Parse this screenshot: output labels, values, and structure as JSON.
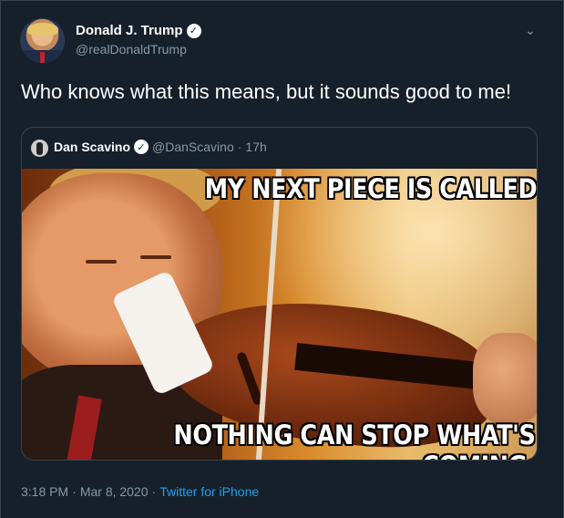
{
  "tweet": {
    "display_name": "Donald J. Trump",
    "handle": "@realDonaldTrump",
    "text": "Who knows what this means, but it sounds good to me!",
    "verified_icon": "verified-badge-icon",
    "menu_icon": "chevron-down-icon"
  },
  "quote": {
    "display_name": "Dan Scavino",
    "handle": "@DanScavino",
    "separator": "·",
    "time": "17h",
    "meme": {
      "top_text": "MY NEXT PIECE IS CALLED",
      "bottom_text": "NOTHING CAN STOP WHAT'S COMING."
    }
  },
  "meta": {
    "time": "3:18 PM",
    "separator1": "·",
    "date": "Mar 8, 2020",
    "separator2": "·",
    "source": "Twitter for iPhone"
  },
  "colors": {
    "background": "#15202b",
    "border": "#38444d",
    "secondary_text": "#8899a6",
    "link": "#1da1f2"
  }
}
